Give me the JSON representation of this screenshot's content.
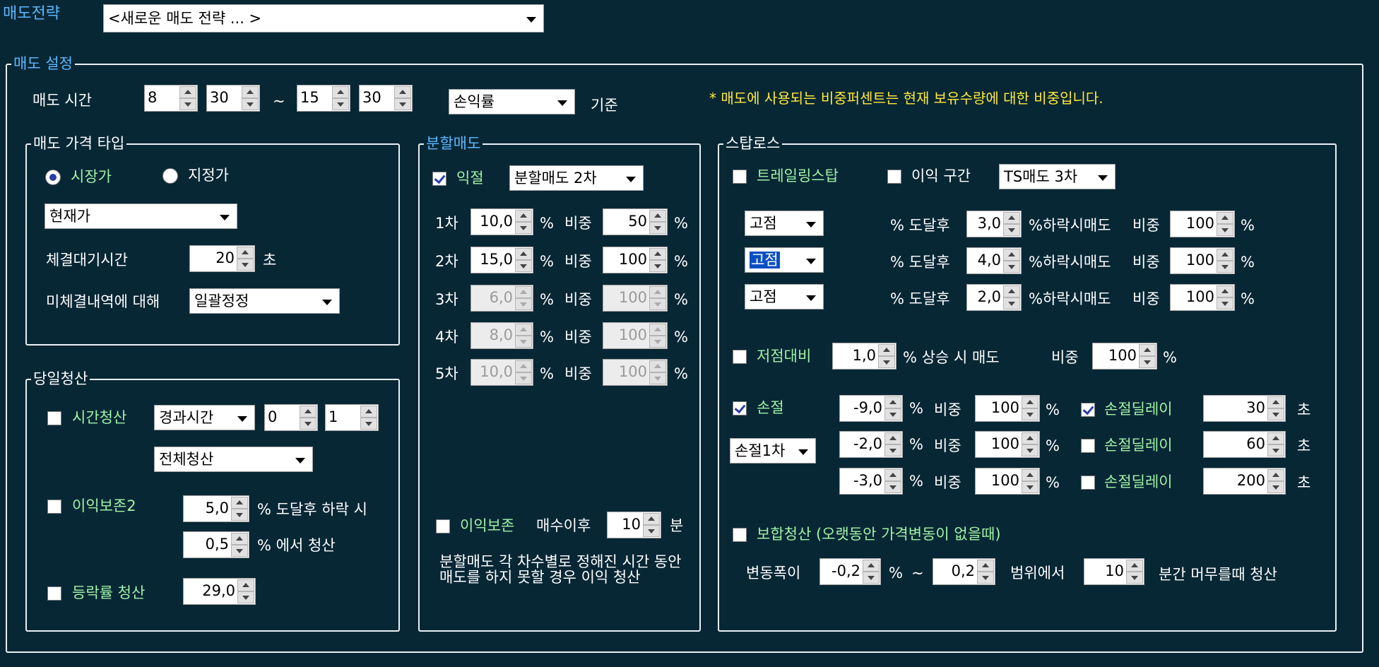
{
  "header": {
    "strategy_label": "매도전략",
    "strategy_combo": "<새로운 매도 전략 ... >"
  },
  "sell_settings": {
    "title": "매도 설정",
    "time_label": "매도 시간",
    "start_hour": "8",
    "start_min": "30",
    "tilde": "~",
    "end_hour": "15",
    "end_min": "30",
    "basis_combo": "손익률",
    "basis_label": "기준",
    "notice": "* 매도에 사용되는 비중퍼센트는 현재 보유수량에 대한 비중입니다."
  },
  "price_type": {
    "title": "매도 가격 타입",
    "market_label": "시장가",
    "limit_label": "지정가",
    "price_combo": "현재가",
    "wait_label": "체결대기시간",
    "wait_value": "20",
    "wait_unit": "초",
    "unfilled_label": "미체결내역에 대해",
    "unfilled_combo": "일괄정정"
  },
  "day_clear": {
    "title": "당일청산",
    "time_clear_label": "시간청산",
    "elapsed_combo": "경과시간",
    "time_a": "0",
    "time_b": "1",
    "all_clear_combo": "전체청산",
    "profit_keep2_label": "이익보존2",
    "reach_value": "5,0",
    "reach_text": "% 도달후 하락 시",
    "clear_value": "0,5",
    "clear_text": "% 에서 청산",
    "rise_clear_label": "등락률 청산",
    "rise_value": "29,0"
  },
  "split_sell": {
    "title": "분할매도",
    "profit_label": "익절",
    "split_combo": "분할매도 2차",
    "pct": "%",
    "weight_label": "비중",
    "rows": [
      {
        "label": "1차",
        "value": "10,0",
        "weight": "50"
      },
      {
        "label": "2차",
        "value": "15,0",
        "weight": "100"
      },
      {
        "label": "3차",
        "value": "6,0",
        "weight": "100"
      },
      {
        "label": "4차",
        "value": "8,0",
        "weight": "100"
      },
      {
        "label": "5차",
        "value": "10,0",
        "weight": "100"
      }
    ],
    "profit_keep_label": "이익보존",
    "after_buy_label": "매수이후",
    "minutes_value": "10",
    "minutes_unit": "분",
    "note": "분할매도 각 차수별로 정해진 시간 동안 매도를 하지 못할 경우 이익 청산"
  },
  "stoploss": {
    "title": "스탑로스",
    "trailing_label": "트레일링스탑",
    "profit_range_label": "이익 구간",
    "ts_combo": "TS매도 3차",
    "reach_text": "% 도달후",
    "fall_text": "%하락시매도",
    "weight_label": "비중",
    "pct": "%",
    "ts_rows": [
      {
        "mode": "고점",
        "value": "3,0",
        "weight": "100"
      },
      {
        "mode": "고점",
        "value": "4,0",
        "weight": "100"
      },
      {
        "mode": "고점",
        "value": "2,0",
        "weight": "100"
      }
    ],
    "low_label": "저점대비",
    "low_value": "1,0",
    "low_text": "% 상승 시 매도",
    "low_weight": "100",
    "loss_label": "손절",
    "loss_combo": "손절1차",
    "delay_label": "손절딜레이",
    "sec_unit": "초",
    "loss_rows": [
      {
        "value": "-9,0",
        "weight": "100",
        "delay": "30"
      },
      {
        "value": "-2,0",
        "weight": "100",
        "delay": "60"
      },
      {
        "value": "-3,0",
        "weight": "100",
        "delay": "200"
      }
    ],
    "hold_label": "보합청산 (오랫동안 가격변동이 없을때)",
    "range_label": "변동폭이",
    "range_min": "-0,2",
    "range_max": "0,2",
    "range_text": "범위에서",
    "hold_minutes": "10",
    "hold_text": "분간 머무를때 청산"
  }
}
